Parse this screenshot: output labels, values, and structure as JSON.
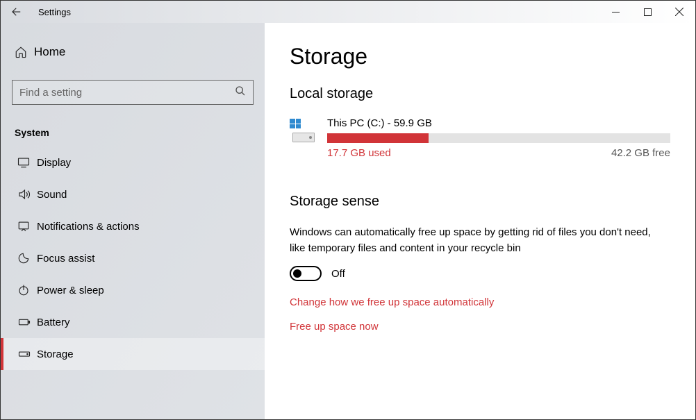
{
  "titlebar": {
    "title": "Settings"
  },
  "sidebar": {
    "home_label": "Home",
    "search_placeholder": "Find a setting",
    "section_label": "System",
    "items": [
      {
        "label": "Display"
      },
      {
        "label": "Sound"
      },
      {
        "label": "Notifications & actions"
      },
      {
        "label": "Focus assist"
      },
      {
        "label": "Power & sleep"
      },
      {
        "label": "Battery"
      },
      {
        "label": "Storage"
      }
    ]
  },
  "main": {
    "page_title": "Storage",
    "local_storage_heading": "Local storage",
    "disk": {
      "name": "This PC (C:) - 59.9 GB",
      "used_text": "17.7 GB used",
      "free_text": "42.2 GB free",
      "fill_percent": "29.5%"
    },
    "storage_sense_heading": "Storage sense",
    "sense_description": "Windows can automatically free up space by getting rid of files you don't need, like temporary files and content in your recycle bin",
    "toggle_label": "Off",
    "link_change": "Change how we free up space automatically",
    "link_freeup": "Free up space now"
  }
}
